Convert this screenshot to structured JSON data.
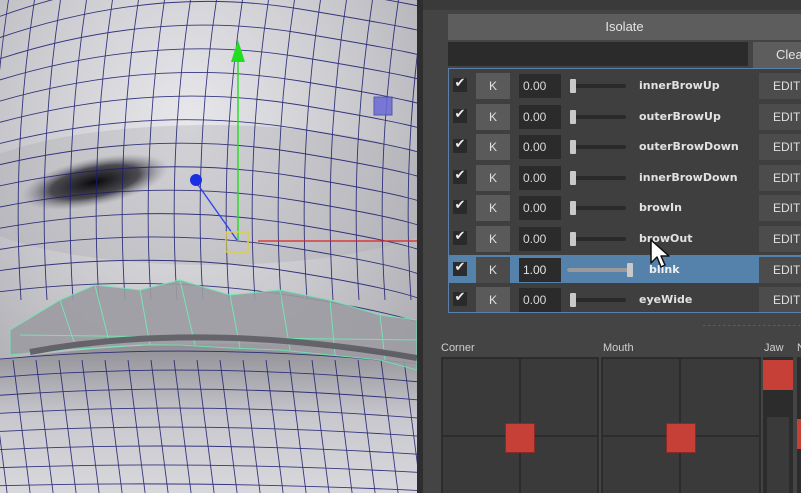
{
  "isolate_label": "Isolate",
  "clear_label": "Clear",
  "filter_value": "",
  "shapes": [
    {
      "checked": true,
      "key_label": "K",
      "value": "0.00",
      "level": 0.0,
      "name": "innerBrowUp",
      "edit_label": "EDIT",
      "selected": false
    },
    {
      "checked": true,
      "key_label": "K",
      "value": "0.00",
      "level": 0.0,
      "name": "outerBrowUp",
      "edit_label": "EDIT",
      "selected": false
    },
    {
      "checked": true,
      "key_label": "K",
      "value": "0.00",
      "level": 0.0,
      "name": "outerBrowDown",
      "edit_label": "EDIT",
      "selected": false
    },
    {
      "checked": true,
      "key_label": "K",
      "value": "0.00",
      "level": 0.0,
      "name": "innerBrowDown",
      "edit_label": "EDIT",
      "selected": false
    },
    {
      "checked": true,
      "key_label": "K",
      "value": "0.00",
      "level": 0.0,
      "name": "browIn",
      "edit_label": "EDIT",
      "selected": false
    },
    {
      "checked": true,
      "key_label": "K",
      "value": "0.00",
      "level": 0.0,
      "name": "browOut",
      "edit_label": "EDIT",
      "selected": false
    },
    {
      "checked": true,
      "key_label": "K",
      "value": "1.00",
      "level": 1.0,
      "name": "blink",
      "edit_label": "EDIT",
      "selected": true
    },
    {
      "checked": true,
      "key_label": "K",
      "value": "0.00",
      "level": 0.0,
      "name": "eyeWide",
      "edit_label": "EDIT",
      "selected": false
    }
  ],
  "check_glyph": "✔",
  "sections": {
    "corner": "Corner",
    "mouth": "Mouth",
    "jaw": "Jaw",
    "next": "N"
  },
  "colors": {
    "selection": "#5482ab",
    "control_handle": "#c64037",
    "manipulator_y": "#22dd22",
    "manipulator_x": "#dd2222",
    "wire": "#1a1a6e",
    "lash_wire": "#6ee8b0"
  },
  "icons": {
    "move_manipulator": "move-arrow-icon",
    "pivot": "pivot-box-icon",
    "cursor": "mouse-pointer-icon"
  }
}
